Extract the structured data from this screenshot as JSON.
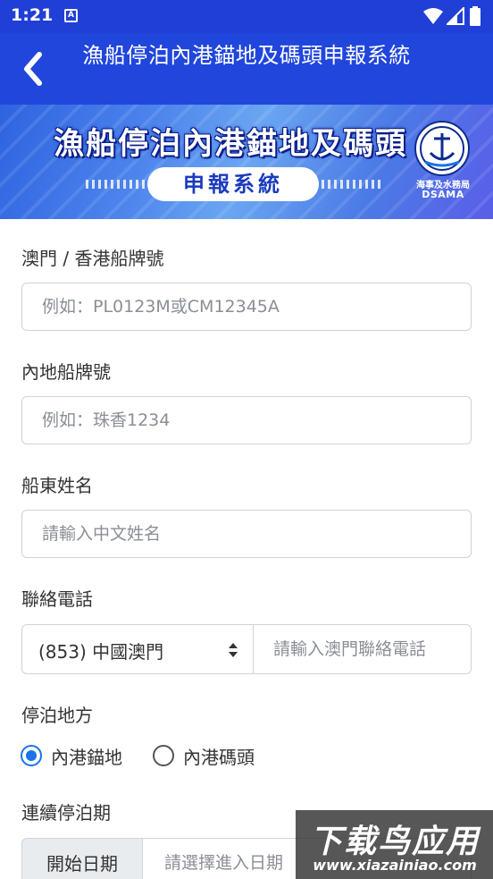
{
  "status_bar": {
    "time": "1:21",
    "notification_icon_letter": "A"
  },
  "header": {
    "title": "漁船停泊內港錨地及碼頭申報系統",
    "back_icon": "chevron-left-icon"
  },
  "banner": {
    "title": "漁船停泊內港錨地及碼頭",
    "subtitle": "申報系統",
    "logo_cn": "海事及水務局",
    "logo_en": "DSAMA"
  },
  "form": {
    "macau_hk_plate": {
      "label": "澳門 / 香港船牌號",
      "placeholder": "例如：PL0123M或CM12345A",
      "value": ""
    },
    "mainland_plate": {
      "label": "內地船牌號",
      "placeholder": "例如：珠香1234",
      "value": ""
    },
    "owner_name": {
      "label": "船東姓名",
      "placeholder": "請輸入中文姓名",
      "value": ""
    },
    "phone": {
      "label": "聯絡電話",
      "country_selected": "(853) 中國澳門",
      "placeholder": "請輸入澳門聯絡電話",
      "value": ""
    },
    "berth_place": {
      "label": "停泊地方",
      "options": [
        {
          "label": "內港錨地",
          "checked": true
        },
        {
          "label": "內港碼頭",
          "checked": false
        }
      ]
    },
    "period": {
      "label": "連續停泊期",
      "start_label": "開始日期",
      "start_placeholder": "請選擇進入日期"
    }
  },
  "watermark": {
    "cn": "下载鸟应用",
    "en": "www.xiazainiao.com"
  },
  "colors": {
    "status_bar": "#1f3fd6",
    "app_bar": "#2146dc",
    "radio_accent": "#1a73e8"
  }
}
